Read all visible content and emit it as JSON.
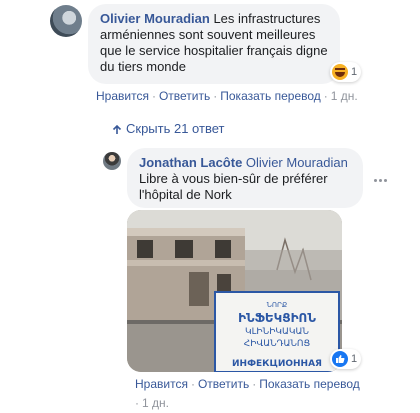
{
  "main_comment": {
    "author": "Olivier Mouradian",
    "text": "Les infrastructures arméniennes sont souvent meilleures que le service hospitalier français digne du tiers monde",
    "reaction_count": "1",
    "reaction_icon": "haha-icon",
    "actions": {
      "like": "Нравится",
      "reply": "Ответить",
      "translate": "Показать перевод",
      "time": "1 дн."
    }
  },
  "hide_replies": {
    "label": "Скрыть 21 ответ"
  },
  "reply": {
    "author": "Jonathan Lacôte",
    "mention": "Olivier Mouradian",
    "text": "Libre à vous bien-sûr de préférer l'hôpital de Nork",
    "photo_sign": {
      "line1": "ՆՈՐՔ",
      "line2": "ԻՆՖԵԿՑԻՈՆ",
      "line3": "ԿԼԻՆԻԿԱԿԱՆ",
      "line4": "ՀԻՎԱՆԴԱՆՈՑ",
      "line5": "ИНФЕКЦИОННАЯ"
    },
    "reaction_count": "1",
    "reaction_icon": "like-icon",
    "actions": {
      "like": "Нравится",
      "reply": "Ответить",
      "translate": "Показать перевод",
      "time": "1 дн."
    }
  },
  "colors": {
    "link": "#385898",
    "bubble": "#f2f3f5",
    "meta": "#90949c",
    "like_blue": "#1877f2"
  }
}
